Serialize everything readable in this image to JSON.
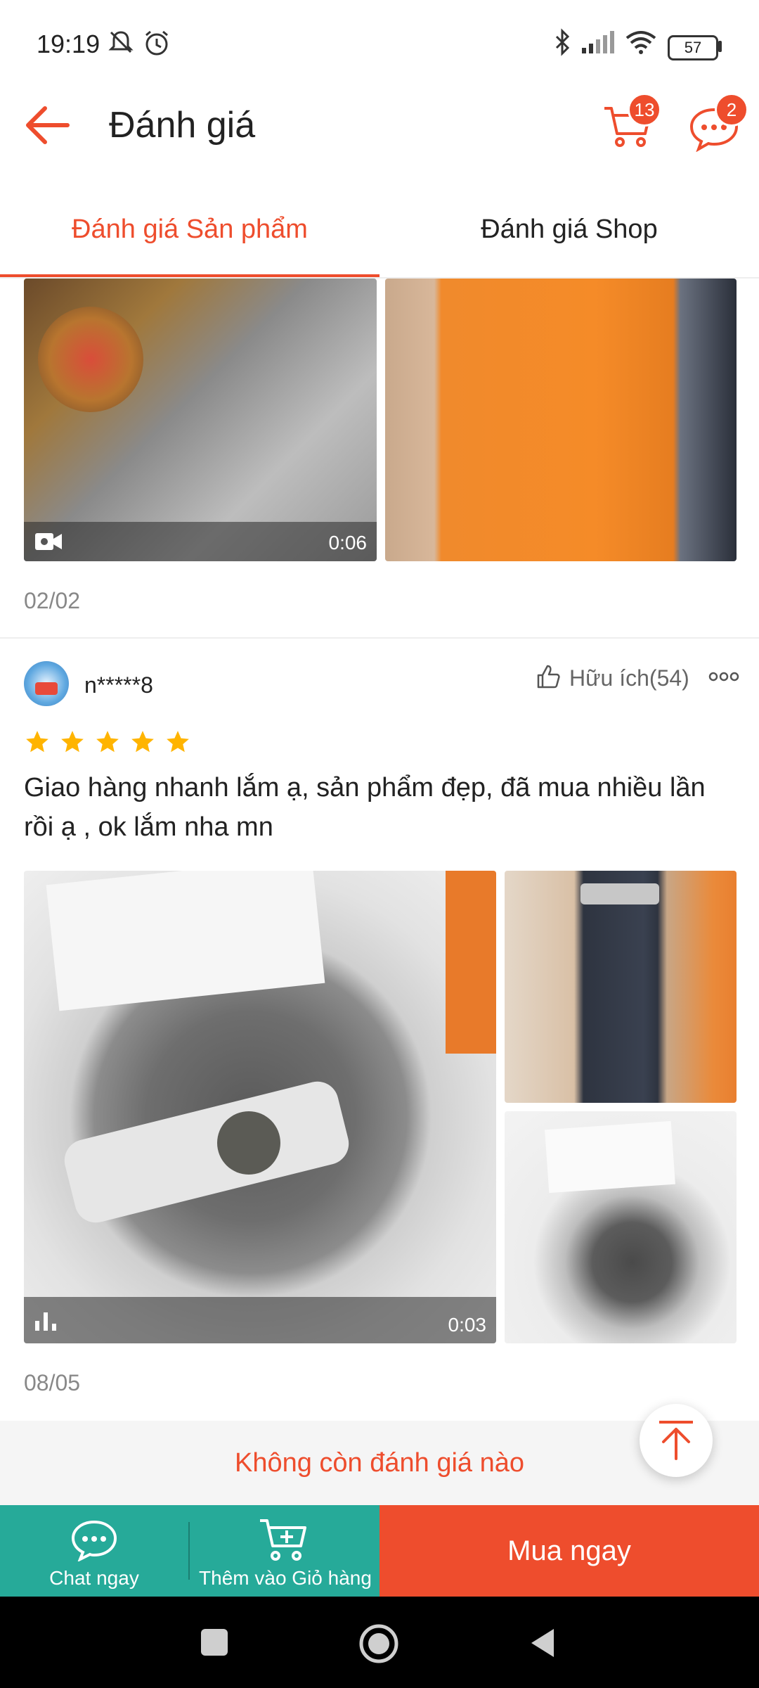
{
  "status_bar": {
    "time": "19:19",
    "battery": "57"
  },
  "header": {
    "title": "Đánh giá",
    "cart_count": "13",
    "chat_count": "2"
  },
  "tabs": [
    {
      "label": "Đánh giá Sản phẩm",
      "active": true
    },
    {
      "label": "Đánh giá Shop",
      "active": false
    }
  ],
  "review_1": {
    "video_duration": "0:06",
    "date": "02/02"
  },
  "review_2": {
    "username": "n*****8",
    "helpful_label": "Hữu ích(54)",
    "rating": 5,
    "text": "Giao hàng nhanh lắm ạ, sản phẩm đẹp, đã mua nhiều lần rồi ạ , ok lắm nha mn",
    "video_duration": "0:03",
    "date": "08/05"
  },
  "end_message": "Không còn đánh giá nào",
  "bottom_bar": {
    "chat_label": "Chat ngay",
    "add_cart_label": "Thêm vào Giỏ hàng",
    "buy_label": "Mua ngay"
  },
  "colors": {
    "accent": "#ee4d2d",
    "teal": "#26aa99",
    "star": "#ffb400"
  }
}
